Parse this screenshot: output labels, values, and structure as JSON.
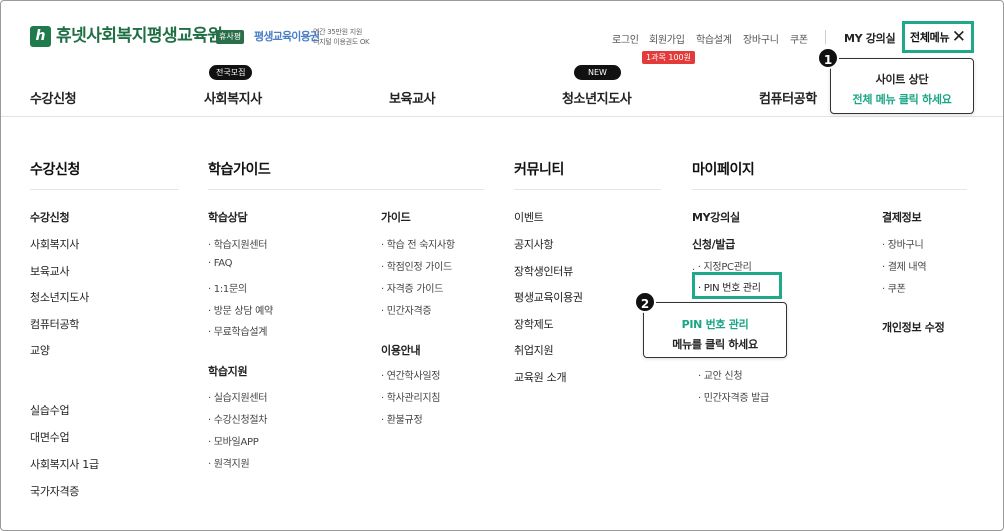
{
  "header": {
    "logo_mark": "h",
    "logo_text": "휴넷사회복지평생교육원",
    "logo_tag": "휴사평",
    "sub_logo": "평생교육이용권",
    "sub_logo_desc_1": "연간 35만원 지원",
    "sub_logo_desc_2": "디지털 이용권도 OK",
    "util": [
      "로그인",
      "회원가입",
      "학습설계",
      "장바구니",
      "쿠폰"
    ],
    "promo_badge": "1과목 100원",
    "my_class": "MY 강의실",
    "all_menu": "전체메뉴",
    "close_icon": "✕"
  },
  "gnb": {
    "items": [
      "수강신청",
      "사회복지사",
      "보육교사",
      "청소년지도사",
      "컴퓨터공학"
    ],
    "badge_recruit": "전국모집",
    "badge_new": "NEW"
  },
  "mega": {
    "col1": {
      "title": "수강신청",
      "items": [
        "수강신청",
        "사회복지사",
        "보육교사",
        "청소년지도사",
        "컴퓨터공학",
        "교양"
      ],
      "items2": [
        "실습수업",
        "대면수업",
        "사회복지사 1급",
        "국가자격증"
      ]
    },
    "col2": {
      "title": "학습가이드",
      "g1_title": "학습상담",
      "g1_items": [
        "· 학습지원센터",
        "· FAQ",
        "· 1:1문의",
        "· 방문 상담 예약",
        "· 무료학습설계"
      ],
      "g2_title": "학습지원",
      "g2_items": [
        "· 실습지원센터",
        "· 수강신청절차",
        "· 모바일APP",
        "· 원격지원"
      ],
      "g3_title": "가이드",
      "g3_items": [
        "· 학습 전 숙지사항",
        "· 학점인정 가이드",
        "· 자격증 가이드",
        "· 민간자격증"
      ],
      "g4_title": "이용안내",
      "g4_items": [
        "· 연간학사일정",
        "· 학사관리지침",
        "· 환불규정"
      ]
    },
    "col3": {
      "title": "커뮤니티",
      "items": [
        "이벤트",
        "공지사항",
        "장학생인터뷰",
        "평생교육이용권",
        "장학제도",
        "취업지원",
        "교육원 소개"
      ]
    },
    "col4": {
      "title": "마이페이지",
      "my_class": "MY강의실",
      "apply_title": "신청/발급",
      "apply_items": [
        ". · 지정PC관리",
        "· PIN 번호 관리",
        "· 교안 신청",
        "· 민간자격증 발급"
      ],
      "pay_title": "결제정보",
      "pay_items": [
        "· 장바구니",
        "· 결제 내역",
        "· 쿠폰"
      ],
      "profile": "개인정보 수정"
    }
  },
  "callouts": {
    "c1_num": "1",
    "c1_line1": "사이트 상단",
    "c1_line2": "전체 메뉴 클릭 하세요",
    "c2_num": "2",
    "c2_line1": "PIN 번호 관리",
    "c2_line2": "메뉴를 클릭 하세요"
  },
  "colors": {
    "accent": "#1fa98a",
    "brand": "#1f6f45",
    "promo": "#e33a3a"
  }
}
